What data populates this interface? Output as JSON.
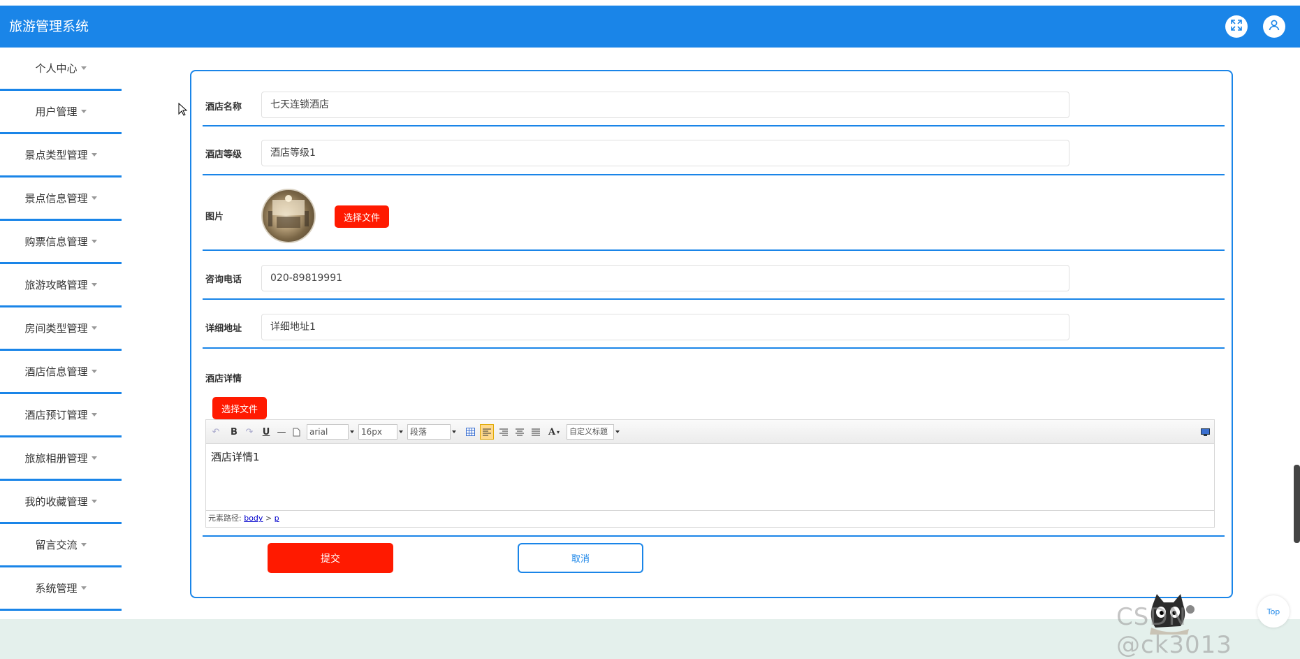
{
  "app": {
    "title": "旅游管理系统"
  },
  "header": {
    "fullscreen_icon": "fullscreen-icon",
    "user_icon": "user-icon"
  },
  "sidebar": {
    "items": [
      {
        "label": "个人中心"
      },
      {
        "label": "用户管理"
      },
      {
        "label": "景点类型管理"
      },
      {
        "label": "景点信息管理"
      },
      {
        "label": "购票信息管理"
      },
      {
        "label": "旅游攻略管理"
      },
      {
        "label": "房间类型管理"
      },
      {
        "label": "酒店信息管理"
      },
      {
        "label": "酒店预订管理"
      },
      {
        "label": "旅旅相册管理"
      },
      {
        "label": "我的收藏管理"
      },
      {
        "label": "留言交流"
      },
      {
        "label": "系统管理"
      }
    ]
  },
  "form": {
    "hotel_name": {
      "label": "酒店名称",
      "value": "七天连锁酒店"
    },
    "hotel_level": {
      "label": "酒店等级",
      "value": "酒店等级1"
    },
    "image": {
      "label": "图片",
      "button": "选择文件"
    },
    "phone": {
      "label": "咨询电话",
      "value": "020-89819991"
    },
    "address": {
      "label": "详细地址",
      "value": "详细地址1"
    },
    "details": {
      "label": "酒店详情",
      "upload_button": "选择文件",
      "editor": {
        "font_family": "arial",
        "font_size": "16px",
        "paragraph": "段落",
        "custom_title": "自定义标题",
        "content": "酒店详情1",
        "path_label": "元素路径:",
        "path_body": "body",
        "path_sep": ">",
        "path_p": "p"
      }
    },
    "submit_label": "提交",
    "cancel_label": "取消"
  },
  "watermark": "CSDN @ck3013",
  "top_button": "Top",
  "colors": {
    "primary": "#1a85e8",
    "danger": "#ff1a00"
  }
}
